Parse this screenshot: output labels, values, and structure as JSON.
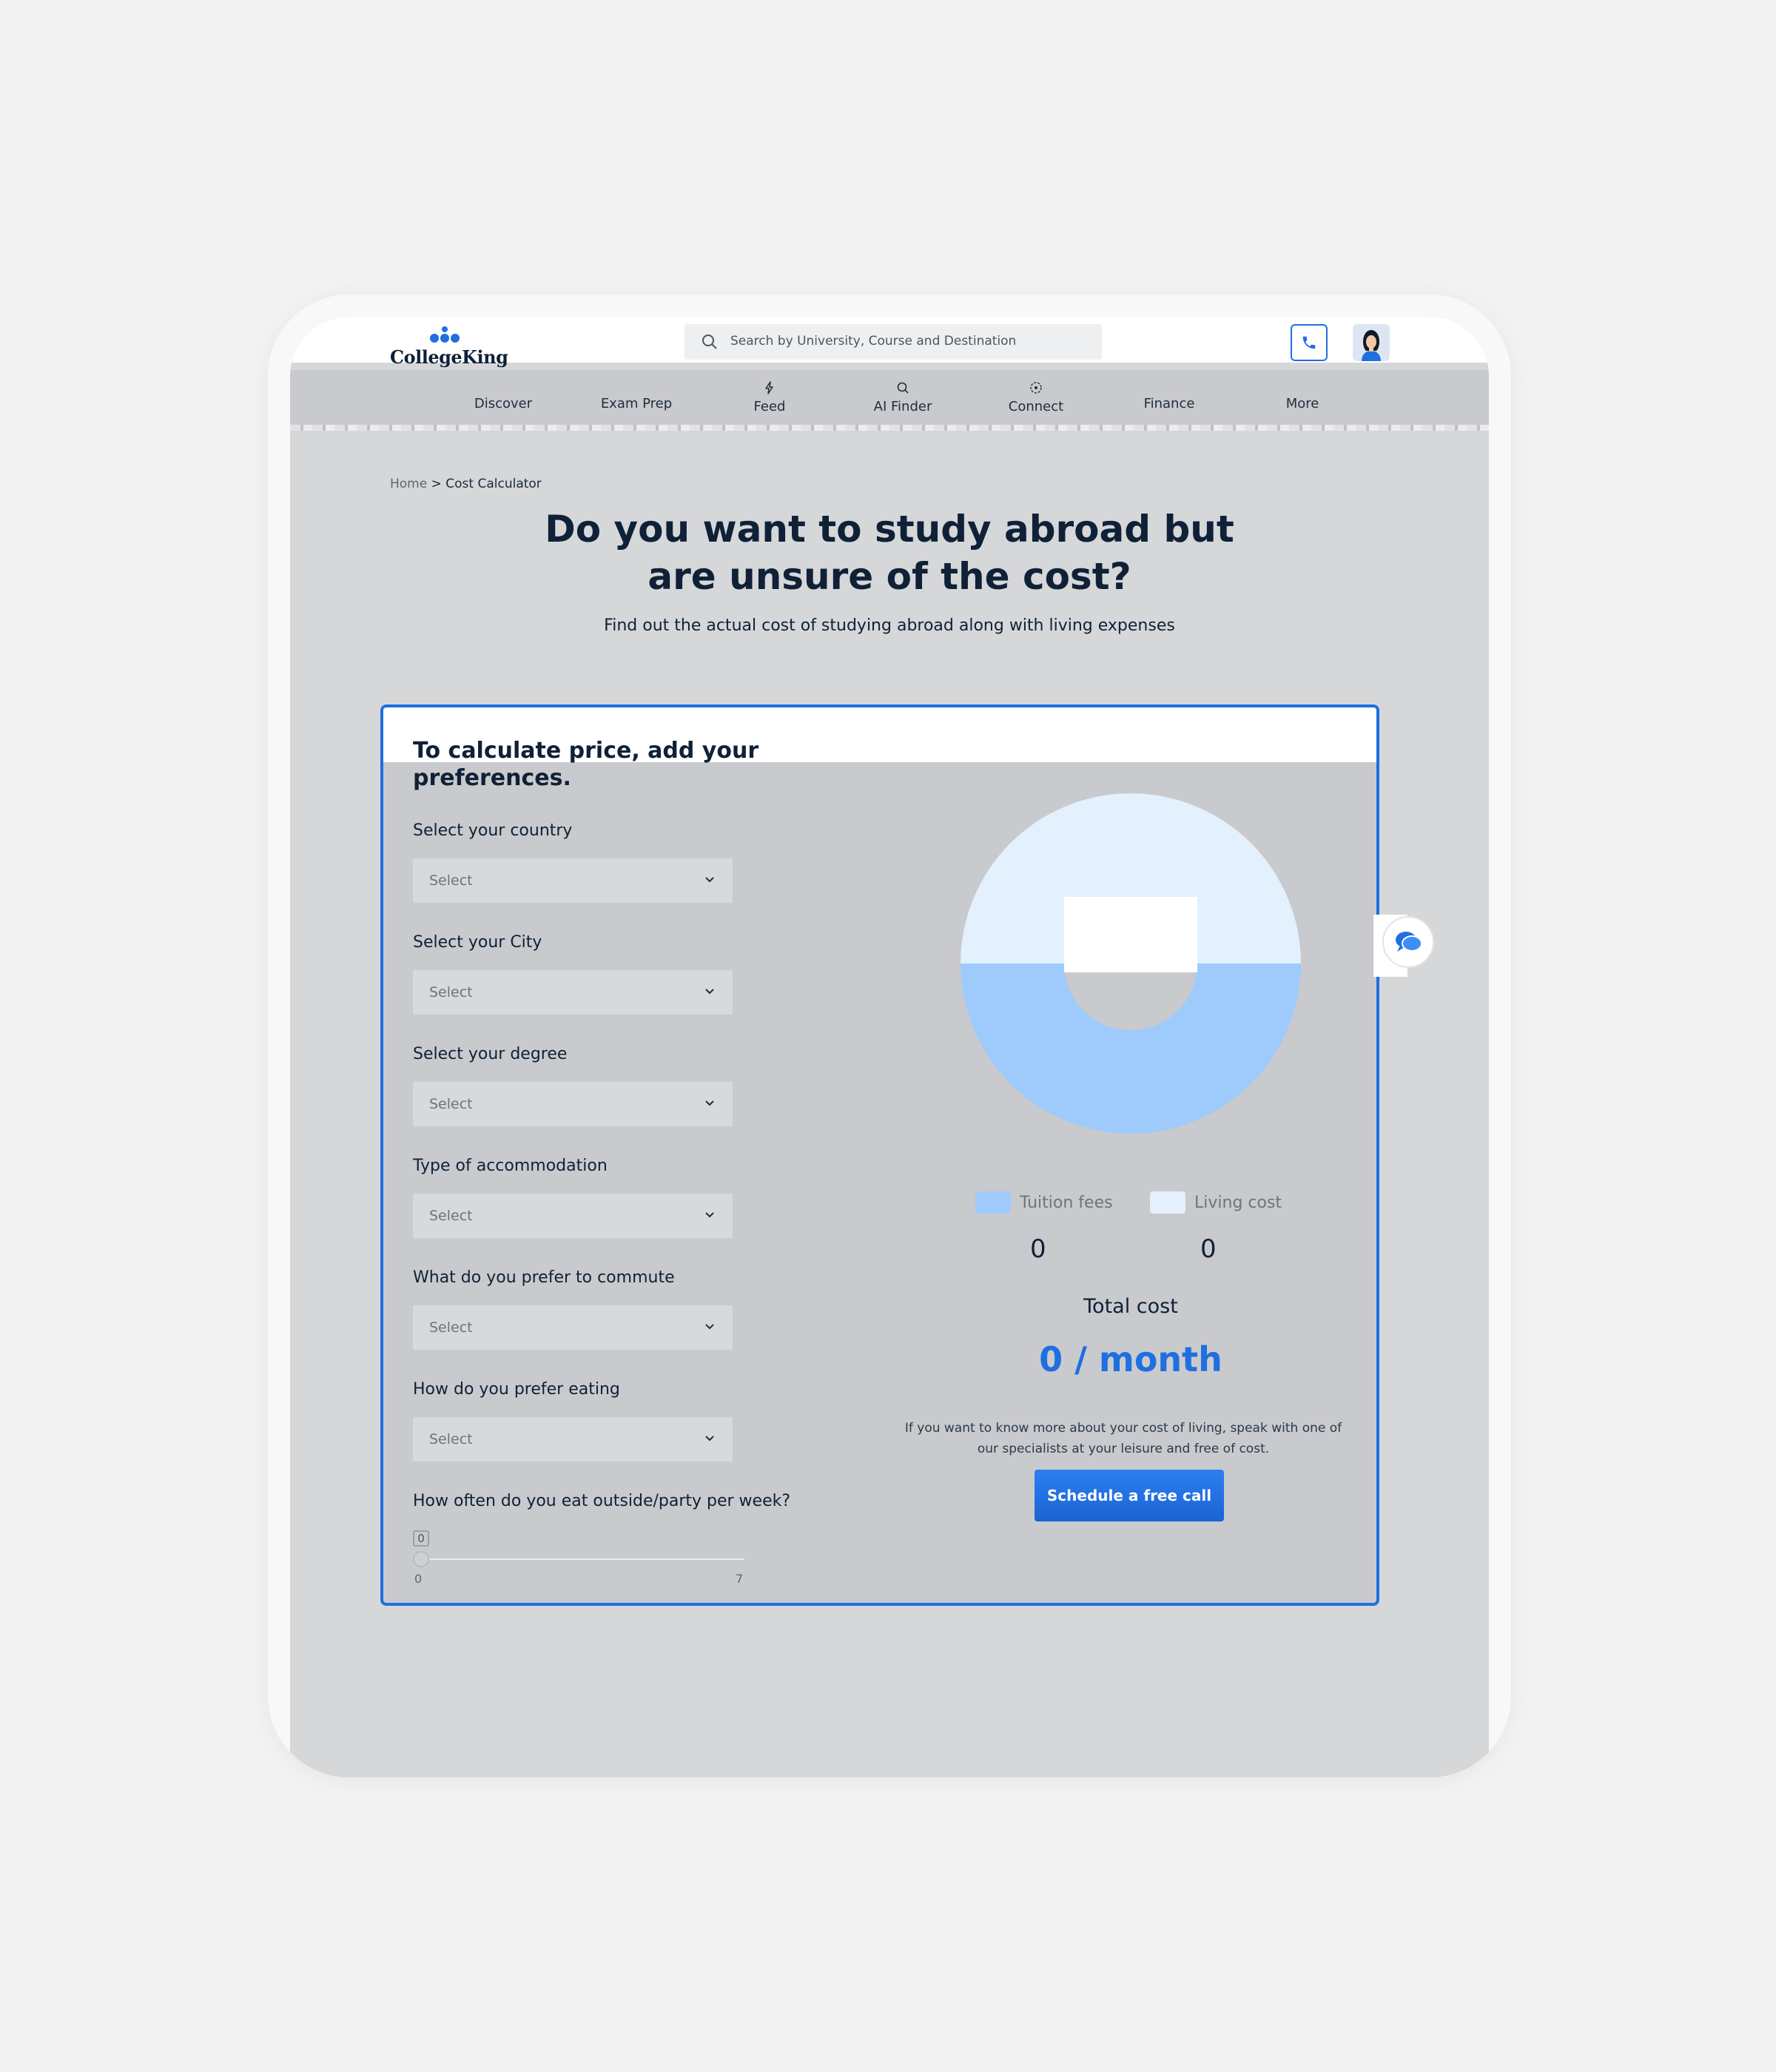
{
  "header": {
    "logo_text": "CollegeKing",
    "search_placeholder": "Search by University, Course and Destination"
  },
  "nav": {
    "items": [
      {
        "label": "Discover",
        "icon": null
      },
      {
        "label": "Exam Prep",
        "icon": null
      },
      {
        "label": "Feed",
        "icon": "bolt-icon"
      },
      {
        "label": "AI Finder",
        "icon": "search-icon"
      },
      {
        "label": "Connect",
        "icon": "connect-icon"
      },
      {
        "label": "Finance",
        "icon": null
      },
      {
        "label": "More",
        "icon": null
      }
    ]
  },
  "breadcrumb": {
    "home": "Home",
    "separator": ">",
    "current": "Cost Calculator"
  },
  "hero": {
    "title_line1": "Do you want to study abroad but",
    "title_line2": "are unsure of the cost?",
    "subtitle": "Find out the actual cost of studying abroad along with living expenses"
  },
  "calculator": {
    "title": "To calculate price, add your preferences.",
    "fields": [
      {
        "label": "Select your country",
        "value": "Select"
      },
      {
        "label": "Select your City",
        "value": "Select"
      },
      {
        "label": "Select your degree",
        "value": "Select"
      },
      {
        "label": "Type of accommodation",
        "value": "Select"
      },
      {
        "label": "What do you prefer to commute",
        "value": "Select"
      },
      {
        "label": "How do you prefer eating",
        "value": "Select"
      }
    ],
    "slider": {
      "label": "How often do you eat outside/party per week?",
      "value": 0,
      "min": 0,
      "max": 7,
      "value_text": "0",
      "min_text": "0",
      "max_text": "7"
    }
  },
  "summary": {
    "legend": [
      {
        "label": "Tuition fees",
        "value": "0",
        "color": "#9ecbfb"
      },
      {
        "label": "Living cost",
        "value": "0",
        "color": "#e3f0fd"
      }
    ],
    "total_label": "Total cost",
    "total_value": "0 / month",
    "info": "If you want to know more about your cost of living, speak with one of our specialists at your leisure and free of cost.",
    "cta": "Schedule a free call",
    "accent": "#1f6fe0"
  }
}
